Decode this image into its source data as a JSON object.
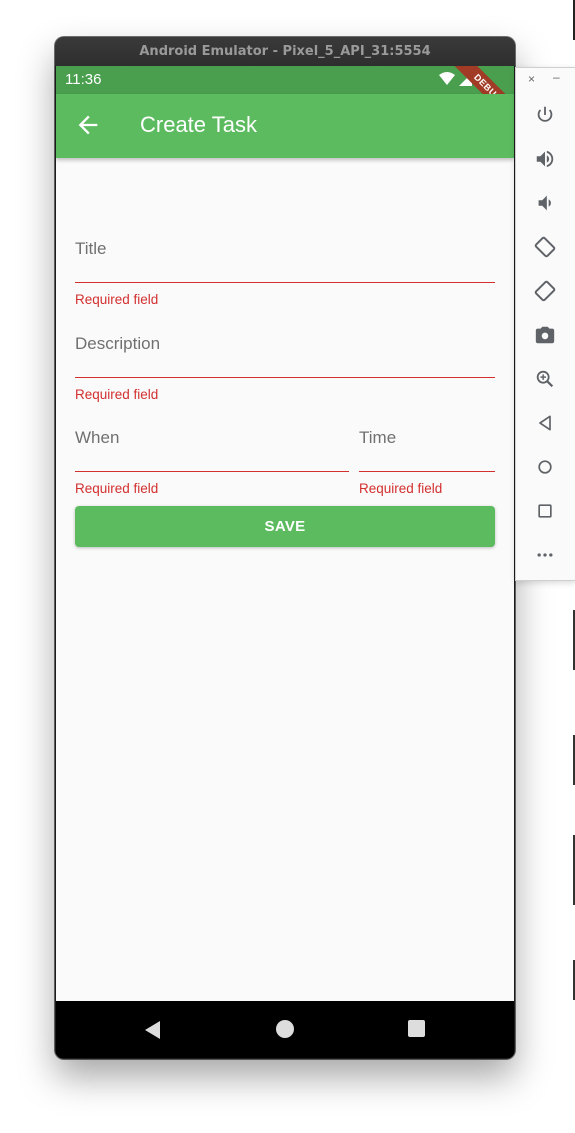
{
  "emulator": {
    "window_title": "Android Emulator - Pixel_5_API_31:5554"
  },
  "status_bar": {
    "time": "11:36",
    "debug_banner": "DEBUG"
  },
  "app_bar": {
    "back_icon": "arrow-back-icon",
    "title": "Create Task"
  },
  "form": {
    "title_field": {
      "label": "Title",
      "error": "Required field"
    },
    "description_field": {
      "label": "Description",
      "error": "Required field"
    },
    "when_field": {
      "label": "When",
      "error": "Required field"
    },
    "time_field": {
      "label": "Time",
      "error": "Required field"
    },
    "save_label": "SAVE"
  },
  "colors": {
    "primary": "#5cbb5f",
    "status_bar": "#4a9f4e",
    "error": "#d32f2f",
    "background": "#fafafa"
  },
  "side_toolbar": {
    "close_label": "×",
    "minimize_label": "–",
    "buttons": [
      "power-icon",
      "volume-up-icon",
      "volume-down-icon",
      "rotate-left-icon",
      "rotate-right-icon",
      "camera-icon",
      "zoom-icon",
      "back-icon",
      "home-icon",
      "overview-icon",
      "more-icon"
    ]
  }
}
